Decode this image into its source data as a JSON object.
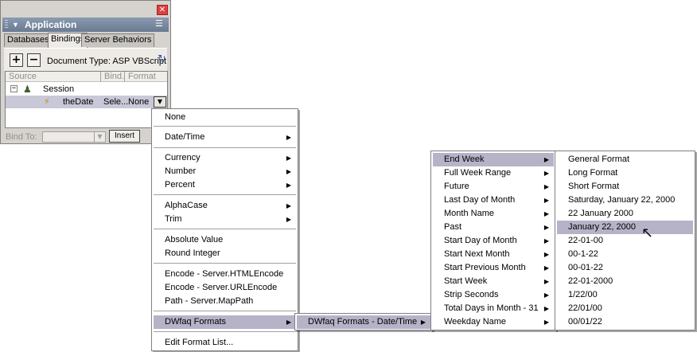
{
  "panel": {
    "title": "Application",
    "tabs": [
      "Databases",
      "Bindings",
      "Server Behaviors"
    ],
    "add_label": "+",
    "remove_label": "−",
    "document_type": "Document Type: ASP VBScript",
    "columns": {
      "source": "Source",
      "binding": "Bind...",
      "format": "Format"
    },
    "tree": {
      "node": "Session",
      "child": {
        "name": "theDate",
        "binding": "Sele...",
        "format": "None"
      }
    },
    "bind_to_label": "Bind To:",
    "insert_label": "Insert"
  },
  "menu1": {
    "items": [
      {
        "label": "None"
      },
      {
        "label": "Date/Time",
        "submenu": true
      },
      {
        "label": "Currency",
        "submenu": true
      },
      {
        "label": "Number",
        "submenu": true
      },
      {
        "label": "Percent",
        "submenu": true
      },
      {
        "label": "AlphaCase",
        "submenu": true
      },
      {
        "label": "Trim",
        "submenu": true
      },
      {
        "label": "Absolute Value"
      },
      {
        "label": "Round Integer"
      },
      {
        "label": "Encode - Server.HTMLEncode"
      },
      {
        "label": "Encode - Server.URLEncode"
      },
      {
        "label": "Path - Server.MapPath"
      },
      {
        "label": "DWfaq Formats",
        "submenu": true,
        "selected": true
      },
      {
        "label": "Edit Format List..."
      }
    ]
  },
  "menu2": {
    "items": [
      {
        "label": "DWfaq Formats - Date/Time",
        "submenu": true,
        "selected": true
      }
    ]
  },
  "menu3": {
    "items": [
      {
        "label": "End Week",
        "selected": true
      },
      {
        "label": "Full Week Range"
      },
      {
        "label": "Future"
      },
      {
        "label": "Last Day of Month"
      },
      {
        "label": "Month Name"
      },
      {
        "label": "Past"
      },
      {
        "label": "Start Day of Month"
      },
      {
        "label": "Start Next Month"
      },
      {
        "label": "Start Previous Month"
      },
      {
        "label": "Start Week"
      },
      {
        "label": "Strip Seconds"
      },
      {
        "label": "Total Days in Month - 31"
      },
      {
        "label": "Weekday Name"
      }
    ]
  },
  "menu4": {
    "items": [
      {
        "label": "General Format"
      },
      {
        "label": "Long Format"
      },
      {
        "label": "Short Format"
      },
      {
        "label": "Saturday, January 22, 2000"
      },
      {
        "label": "22 January 2000"
      },
      {
        "label": "January 22, 2000",
        "selected": true
      },
      {
        "label": "22-01-00"
      },
      {
        "label": "00-1-22"
      },
      {
        "label": "00-01-22"
      },
      {
        "label": "22-01-2000"
      },
      {
        "label": "1/22/00"
      },
      {
        "label": "22/01/00"
      },
      {
        "label": "00/01/22"
      }
    ]
  },
  "icons": {
    "close": "close-icon",
    "collapse": "collapse-triangle-icon",
    "options": "panel-options-icon",
    "refresh": "refresh-icon",
    "session": "session-icon",
    "variable": "variable-icon",
    "submenu": "submenu-arrow-icon",
    "cursor": "mouse-pointer-icon"
  },
  "colors": {
    "titlebar": "#6a7a92",
    "menu_highlight": "#b6b3c8",
    "row_highlight": "#c8c8d8"
  }
}
